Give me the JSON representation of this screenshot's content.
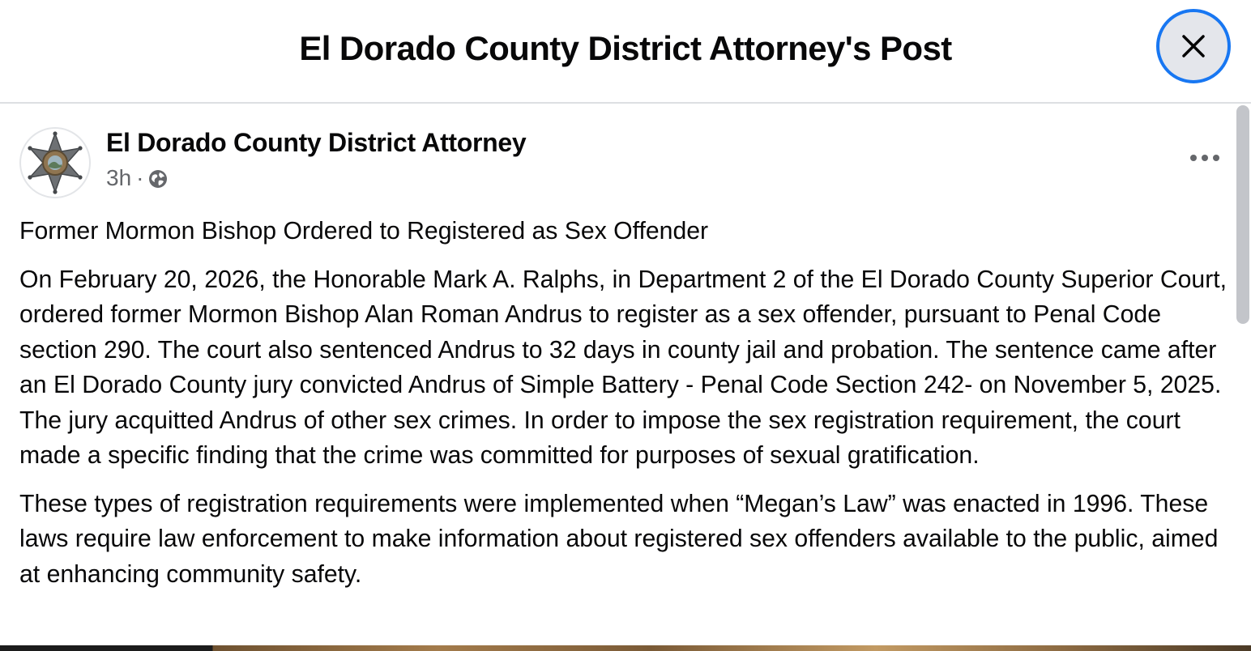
{
  "header": {
    "title": "El Dorado County District Attorney's Post",
    "close_icon": "close-icon"
  },
  "post": {
    "author": "El Dorado County District Attorney",
    "avatar_icon": "sheriff-star-badge",
    "time": "3h",
    "separator": "·",
    "audience_icon": "globe-icon",
    "more_icon": "more-options-icon",
    "paragraphs": [
      "Former Mormon Bishop Ordered to Registered as Sex Offender",
      "On February 20, 2026, the Honorable Mark A. Ralphs, in Department 2 of the El Dorado County Superior Court, ordered former Mormon Bishop Alan Roman Andrus to register as a sex offender, pursuant to Penal Code section 290. The court also sentenced Andrus to 32 days in county jail and probation. The sentence came after an El Dorado County jury convicted Andrus of Simple Battery - Penal Code Section 242- on November 5, 2025.  The jury acquitted Andrus of other sex crimes. In order to impose the sex registration requirement, the court made a specific finding that the crime was committed for purposes of sexual gratification.",
      "These types of registration requirements were implemented when “Megan’s Law” was enacted in 1996. These laws require law enforcement to make information about registered sex offenders available to the public, aimed at enhancing community safety."
    ]
  },
  "colors": {
    "accent": "#1877f2",
    "text": "#080809",
    "secondary_text": "#65676b",
    "button_bg": "#e4e6eb"
  }
}
